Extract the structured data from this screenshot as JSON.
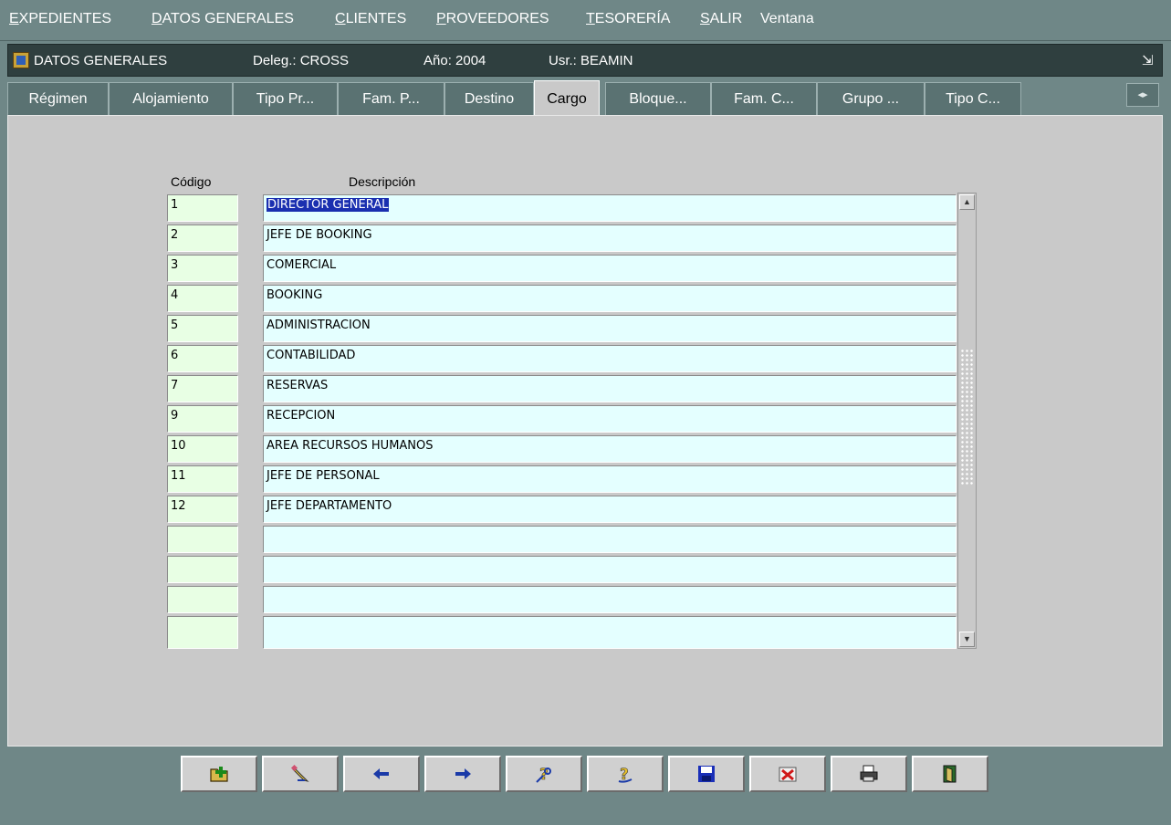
{
  "menu": [
    {
      "first": "E",
      "rest": "XPEDIENTES"
    },
    {
      "first": "D",
      "rest": "ATOS GENERALES"
    },
    {
      "first": "C",
      "rest": "LIENTES"
    },
    {
      "first": "P",
      "rest": "ROVEEDORES"
    },
    {
      "first": "T",
      "rest": "ESORERÍA"
    },
    {
      "first": "S",
      "rest": "ALIR"
    },
    {
      "first": "",
      "rest": "Ventana"
    }
  ],
  "window": {
    "title": "DATOS GENERALES",
    "delegacion": "Deleg.: CROSS",
    "anio": "Año: 2004",
    "usuario": "Usr.: BEAMIN"
  },
  "tabs": [
    {
      "label": "Régimen",
      "active": false
    },
    {
      "label": "Alojamiento",
      "active": false
    },
    {
      "label": "Tipo Pr...",
      "active": false
    },
    {
      "label": "Fam. P...",
      "active": false
    },
    {
      "label": "Destino",
      "active": false
    },
    {
      "label": "Cargo",
      "active": true
    },
    {
      "label": "Bloque...",
      "active": false
    },
    {
      "label": "Fam. C...",
      "active": false
    },
    {
      "label": "Grupo ...",
      "active": false
    },
    {
      "label": "Tipo C...",
      "active": false
    }
  ],
  "table": {
    "headers": {
      "code": "Código",
      "description": "Descripción"
    },
    "rows": [
      {
        "code": "1",
        "description": "DIRECTOR GENERAL"
      },
      {
        "code": "2",
        "description": "JEFE DE BOOKING"
      },
      {
        "code": "3",
        "description": "COMERCIAL"
      },
      {
        "code": "4",
        "description": "BOOKING"
      },
      {
        "code": "5",
        "description": "ADMINISTRACION"
      },
      {
        "code": "6",
        "description": "CONTABILIDAD"
      },
      {
        "code": "7",
        "description": "RESERVAS"
      },
      {
        "code": "9",
        "description": "RECEPCION"
      },
      {
        "code": "10",
        "description": "AREA RECURSOS HUMANOS"
      },
      {
        "code": "11",
        "description": "JEFE DE PERSONAL"
      },
      {
        "code": "12",
        "description": "JEFE DEPARTAMENTO"
      },
      {
        "code": "",
        "description": ""
      },
      {
        "code": "",
        "description": ""
      },
      {
        "code": "",
        "description": ""
      },
      {
        "code": "",
        "description": ""
      }
    ],
    "selected_row": 0
  },
  "toolbar": [
    {
      "name": "new-record-button",
      "icon": "new-record-icon"
    },
    {
      "name": "edit-button",
      "icon": "edit-pencil-icon"
    },
    {
      "name": "previous-button",
      "icon": "arrow-left-icon"
    },
    {
      "name": "next-button",
      "icon": "arrow-right-icon"
    },
    {
      "name": "query-button",
      "icon": "query-key-icon"
    },
    {
      "name": "execute-query-button",
      "icon": "help-query-icon"
    },
    {
      "name": "save-button",
      "icon": "floppy-disk-icon"
    },
    {
      "name": "delete-button",
      "icon": "delete-x-icon"
    },
    {
      "name": "print-button",
      "icon": "printer-icon"
    },
    {
      "name": "exit-button",
      "icon": "exit-door-icon"
    }
  ],
  "colors": {
    "background": "#6f8787",
    "panel": "#c9c9c9",
    "code_field": "#e8ffe4",
    "desc_field": "#e4ffff",
    "selection": "#1a2fb0"
  }
}
